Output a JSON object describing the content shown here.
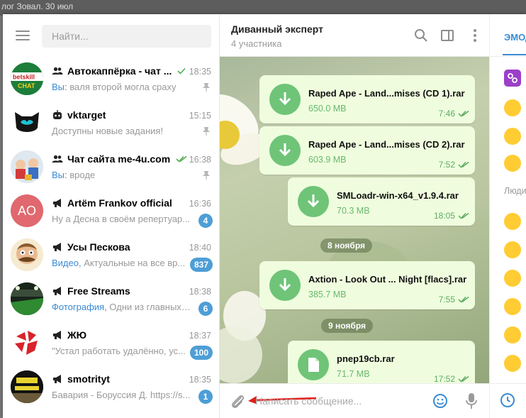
{
  "background": {
    "top_text": "лог Зовал. 30 июл"
  },
  "sidebar": {
    "search_placeholder": "Найти...",
    "chats": [
      {
        "name": "Автокаппёрка - чат ...",
        "type": "group",
        "time": "18:35",
        "sender": "Вы:",
        "preview": " валя второй могла сраху",
        "pinned": true,
        "read": true,
        "avatar": "betskill"
      },
      {
        "name": "vktarget",
        "type": "bot",
        "time": "15:15",
        "sender": "",
        "preview": "Доступны новые задания!",
        "pinned": true,
        "avatar": "vktarget"
      },
      {
        "name": "Чат сайта me-4u.com",
        "type": "group",
        "time": "16:38",
        "sender": "Вы:",
        "preview": " вроде",
        "pinned": true,
        "read": true,
        "avatar": "cartoon"
      },
      {
        "name": "Artëm Frankov official",
        "type": "channel",
        "time": "16:36",
        "sender": "",
        "preview": "Ну а Десна в своём репертуар...",
        "badge": "4",
        "avatar_text": "AO",
        "avatar": "initials"
      },
      {
        "name": "Усы Пескова",
        "type": "channel",
        "time": "18:40",
        "sender": "Видео,",
        "preview": " Актуальные на все вр...",
        "badge": "837",
        "avatar": "caricature"
      },
      {
        "name": "Free Streams",
        "type": "channel",
        "time": "18:38",
        "sender": "Фотография,",
        "preview": " Одни из главных ...",
        "badge": "6",
        "avatar": "stadium"
      },
      {
        "name": "ЖЮ",
        "type": "channel",
        "time": "18:37",
        "sender": "",
        "preview": "\"Устал работать удалённо, ус...",
        "badge": "100",
        "avatar": "ju"
      },
      {
        "name": "smotrityt",
        "type": "channel",
        "time": "18:35",
        "sender": "",
        "preview": "Бавария - Боруссия Д. https://s...",
        "badge": "1",
        "avatar": "smotrityt"
      }
    ]
  },
  "main": {
    "title": "Диванный эксперт",
    "subtitle": "4 участника",
    "messages": [
      {
        "kind": "file",
        "name": "Raped Ape - Land...mises (CD 1).rar",
        "size": "650.0 MB",
        "time": "7:46",
        "icon": "download"
      },
      {
        "kind": "file",
        "name": "Raped Ape - Land...mises (CD 2).rar",
        "size": "603.9 MB",
        "time": "7:52",
        "icon": "download"
      },
      {
        "kind": "file",
        "name": "SMLoadr-win-x64_v1.9.4.rar",
        "size": "70.3 MB",
        "time": "18:05",
        "icon": "download"
      },
      {
        "kind": "date",
        "label": "8 ноября"
      },
      {
        "kind": "file",
        "name": "Axtion - Look Out ... Night [flacs].rar",
        "size": "385.7 MB",
        "time": "7:55",
        "icon": "download"
      },
      {
        "kind": "date",
        "label": "9 ноября"
      },
      {
        "kind": "file",
        "name": "pnep19cb.rar",
        "size": "71.7 MB",
        "time": "17:52",
        "icon": "document"
      }
    ],
    "composer_placeholder": "Написать сообщение..."
  },
  "emoji_panel": {
    "tab_label": "ЭМОДЗИ",
    "section_label": "Люди"
  },
  "colors": {
    "accent": "#3a8bd3",
    "badge": "#4e9ed6",
    "bubble": "#effdde",
    "file_icon": "#6fc478",
    "arrow": "#e0201b"
  }
}
